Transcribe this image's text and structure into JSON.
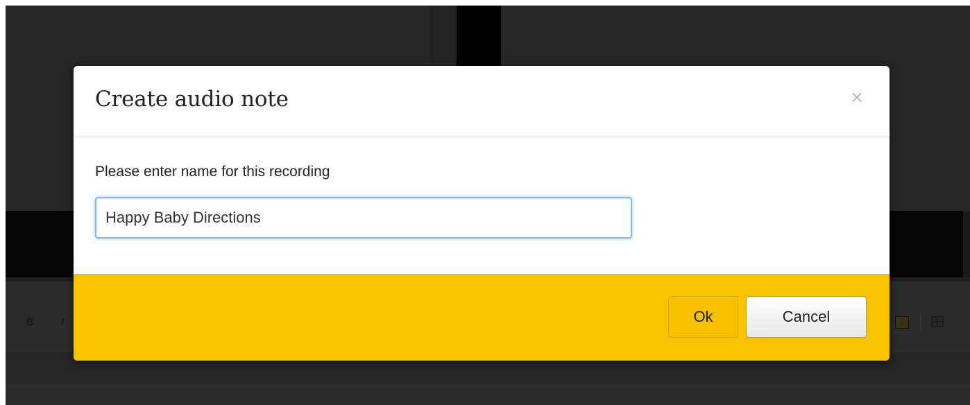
{
  "modal": {
    "title": "Create audio note",
    "close_glyph": "×",
    "close_icon": "close-icon",
    "body": {
      "label": "Please enter name for this recording",
      "input_value": "Happy Baby Directions"
    },
    "footer": {
      "ok_label": "Ok",
      "cancel_label": "Cancel"
    }
  },
  "background_toolbar": {
    "bold_glyph": "B",
    "italic_glyph": "I",
    "icons": [
      "bold-icon",
      "italic-icon",
      "color-swatch-icon",
      "table-icon"
    ]
  },
  "colors": {
    "footer_accent": "#f8c300",
    "ok_button": "#f6bf00",
    "input_focus": "#8bb8ec",
    "backdrop": "#262626"
  }
}
